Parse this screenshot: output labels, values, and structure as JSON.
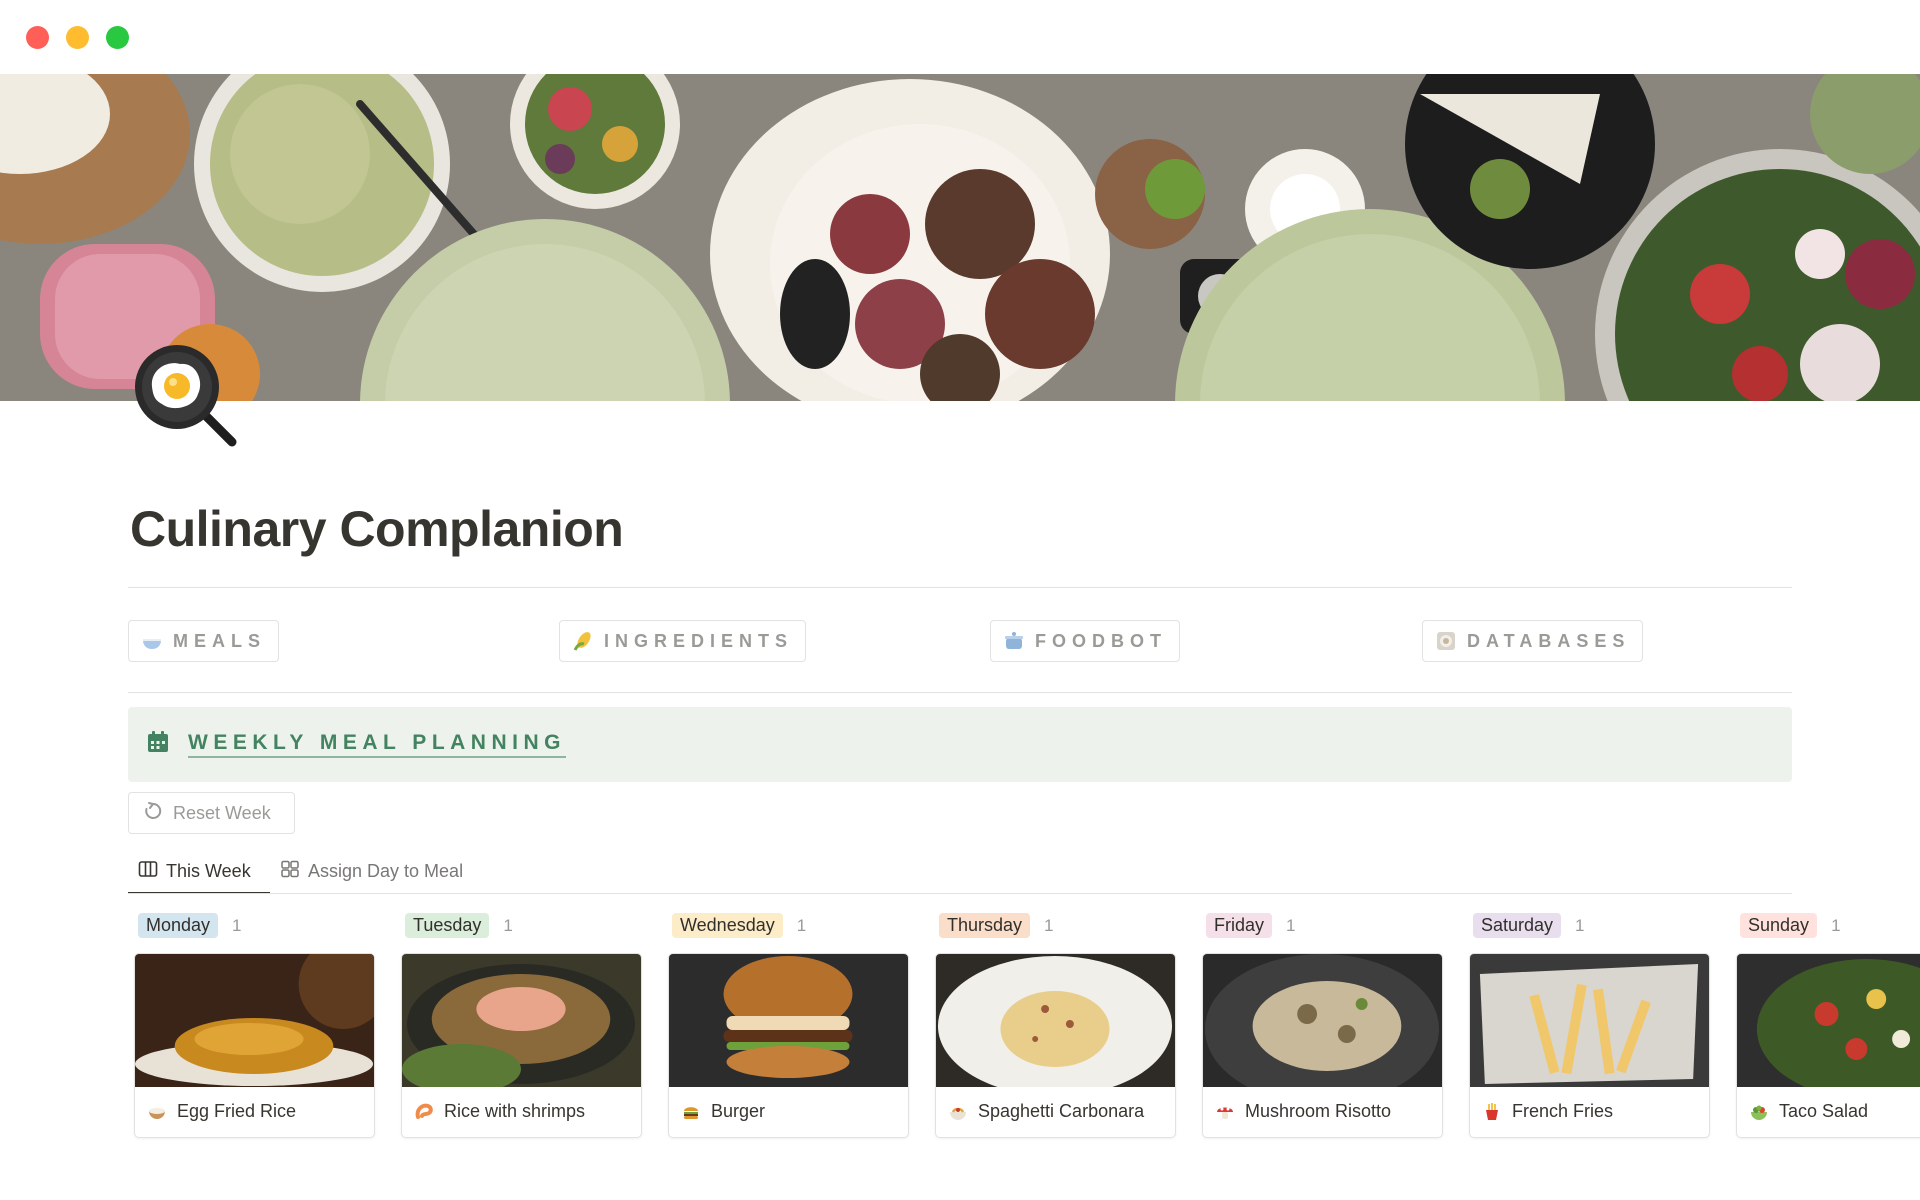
{
  "window": {
    "controls": [
      "close",
      "minimize",
      "maximize"
    ]
  },
  "page": {
    "title": "Culinary Complanion",
    "icon": "fried-egg-pan-icon"
  },
  "nav": [
    {
      "label": "MEALS",
      "icon": "bowl-icon"
    },
    {
      "label": "INGREDIENTS",
      "icon": "corn-icon"
    },
    {
      "label": "FOODBOT",
      "icon": "pot-icon"
    },
    {
      "label": "DATABASES",
      "icon": "cookbook-icon"
    }
  ],
  "section": {
    "heading": "WEEKLY MEAL PLANNING",
    "heading_icon": "calendar-icon"
  },
  "buttons": {
    "reset": "Reset Week"
  },
  "tabs": [
    {
      "label": "This Week",
      "icon": "board-icon",
      "active": true
    },
    {
      "label": "Assign Day to Meal",
      "icon": "gallery-icon",
      "active": false
    }
  ],
  "board": {
    "columns": [
      {
        "day": "Monday",
        "count": "1",
        "color": "#d3e5ef",
        "meal": "Egg Fried Rice",
        "meal_icon": "rice-bowl-icon"
      },
      {
        "day": "Tuesday",
        "count": "1",
        "color": "#dbeddb",
        "meal": "Rice with shrimps",
        "meal_icon": "shrimp-icon"
      },
      {
        "day": "Wednesday",
        "count": "1",
        "color": "#fdecc8",
        "meal": "Burger",
        "meal_icon": "burger-icon"
      },
      {
        "day": "Thursday",
        "count": "1",
        "color": "#fadec9",
        "meal": "Spaghetti Carbonara",
        "meal_icon": "spaghetti-icon"
      },
      {
        "day": "Friday",
        "count": "1",
        "color": "#f5e0e9",
        "meal": "Mushroom Risotto",
        "meal_icon": "mushroom-icon"
      },
      {
        "day": "Saturday",
        "count": "1",
        "color": "#e8deee",
        "meal": "French Fries",
        "meal_icon": "fries-icon"
      },
      {
        "day": "Sunday",
        "count": "1",
        "color": "#ffe2dd",
        "meal": "Taco Salad",
        "meal_icon": "salad-icon"
      }
    ]
  },
  "colors": {
    "callout_bg": "#edf3ec",
    "callout_text": "#448361",
    "text": "#37352f",
    "muted": "#9b9a97"
  }
}
